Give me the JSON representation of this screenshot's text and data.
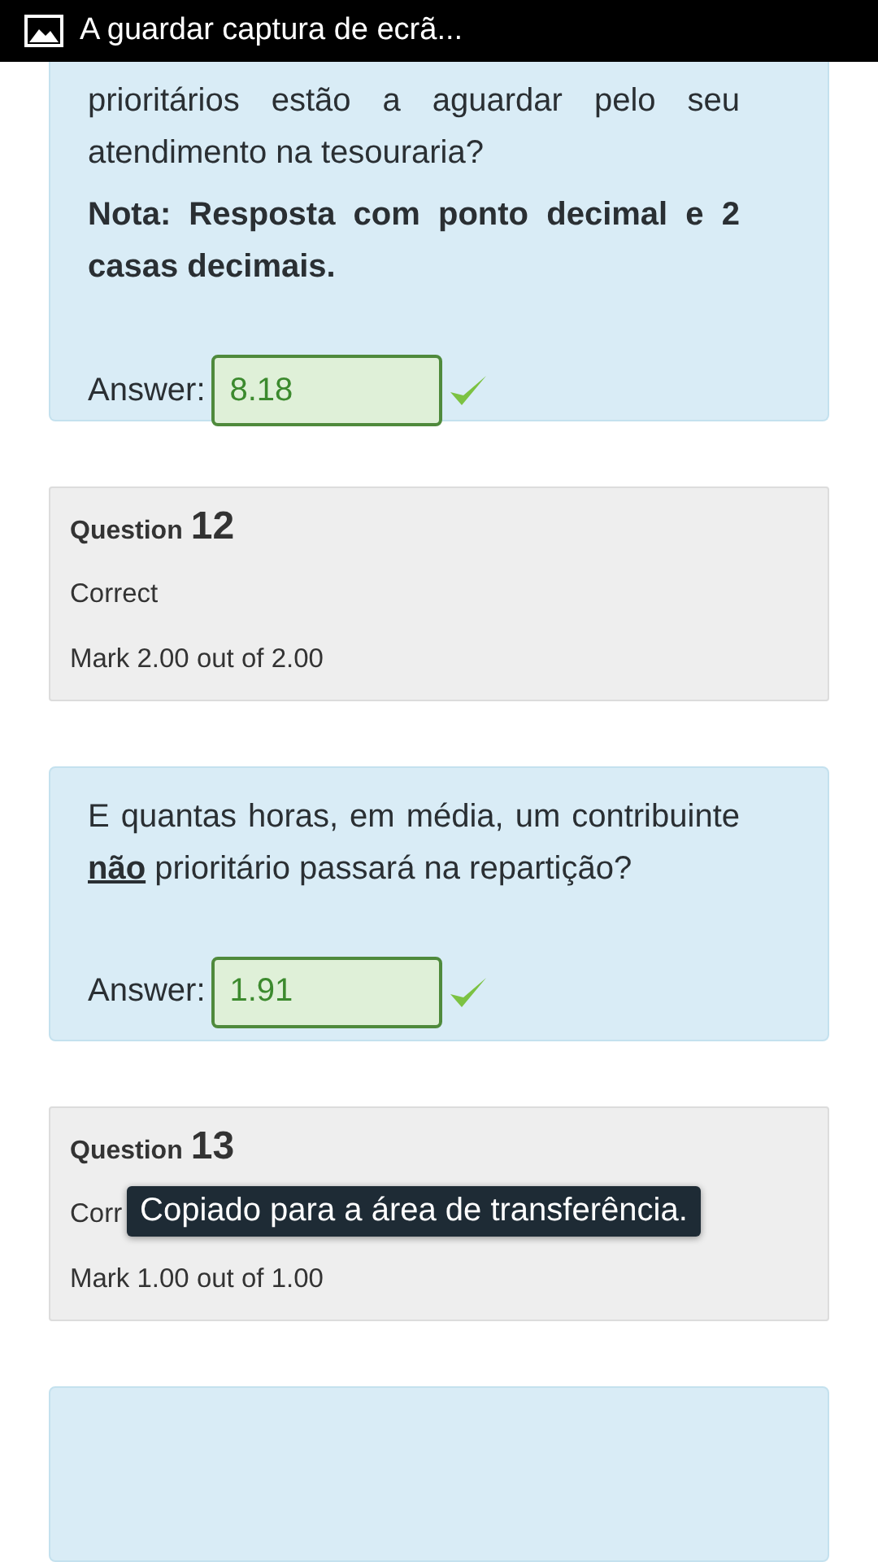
{
  "status_bar": {
    "text": "A guardar captura de ecrã..."
  },
  "blocks": [
    {
      "kind": "question_text",
      "text": "prioritários estão a aguardar pelo seu atendimento na tesouraria?",
      "note": "Nota: Resposta com ponto decimal e 2 casas decimais.",
      "answer_label": "Answer:",
      "answer": {
        "value": "8.18",
        "correct": true
      },
      "cut_top": true
    },
    {
      "kind": "info",
      "label": "Question",
      "number": "12",
      "state": "Correct",
      "mark": "Mark 2.00 out of 2.00"
    },
    {
      "kind": "question_text",
      "text": "E quantas horas, em média, um contribuinte **não** prioritário passará na repartição?",
      "answer_label": "Answer:",
      "answer": {
        "value": "1.91",
        "correct": true
      }
    },
    {
      "kind": "info",
      "label": "Question",
      "number": "13",
      "state": "Corr",
      "mark": "Mark 1.00 out of 1.00",
      "toast": "Copiado para a área de transferência."
    },
    {
      "kind": "question_text"
    }
  ]
}
